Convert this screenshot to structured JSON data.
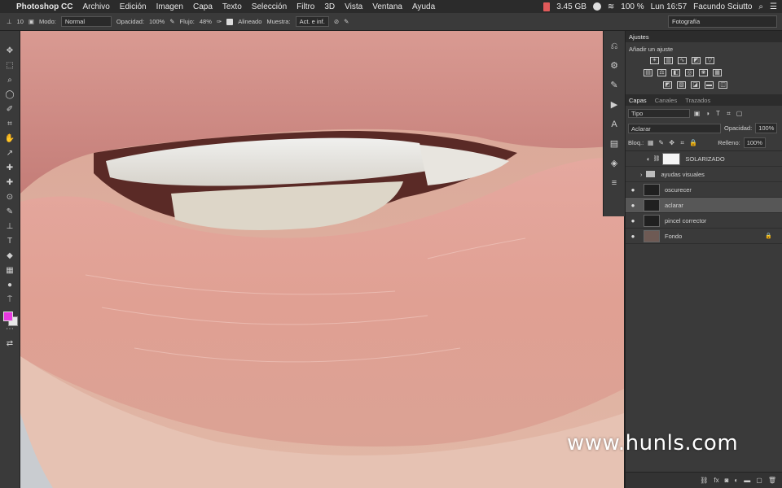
{
  "menubar": {
    "apple": "",
    "app": "Photoshop CC",
    "items": [
      "Archivo",
      "Edición",
      "Imagen",
      "Capa",
      "Texto",
      "Selección",
      "Filtro",
      "3D",
      "Vista",
      "Ventana",
      "Ayuda"
    ],
    "memory": "3.45 GB",
    "battery": "100 %",
    "clock": "Lun 16:57",
    "user": "Facundo Sciutto"
  },
  "options_bar": {
    "brush_size": "10",
    "mode_label": "Modo:",
    "mode_value": "Normal",
    "opacity_label": "Opacidad:",
    "opacity_value": "100%",
    "flow_label": "Flujo:",
    "flow_value": "48%",
    "aligned_label": "Alineado",
    "sample_label": "Muestra:",
    "sample_value": "Act. e inf.",
    "workspace": "Fotografía"
  },
  "adjustments": {
    "tab": "Ajustes",
    "subtitle": "Añadir un ajuste"
  },
  "layers_panel": {
    "tabs": [
      "Capas",
      "Canales",
      "Trazados"
    ],
    "filter": "Tipo",
    "blend_mode": "Aclarar",
    "opacity_label": "Opacidad:",
    "opacity_value": "100%",
    "lock_label": "Bloq.:",
    "fill_label": "Relleno:",
    "fill_value": "100%",
    "layers": [
      {
        "name": "SOLARIZADO"
      },
      {
        "name": "ayudas visuales"
      },
      {
        "name": "oscurecer"
      },
      {
        "name": "aclarar"
      },
      {
        "name": "pincel corrector"
      },
      {
        "name": "Fondo"
      }
    ]
  },
  "watermark": "www.hunls.com",
  "colors": {
    "foreground": "#e83ae0",
    "background": "#e8e8e8",
    "panel": "#3a3a3a",
    "selected_layer": "#575757"
  }
}
